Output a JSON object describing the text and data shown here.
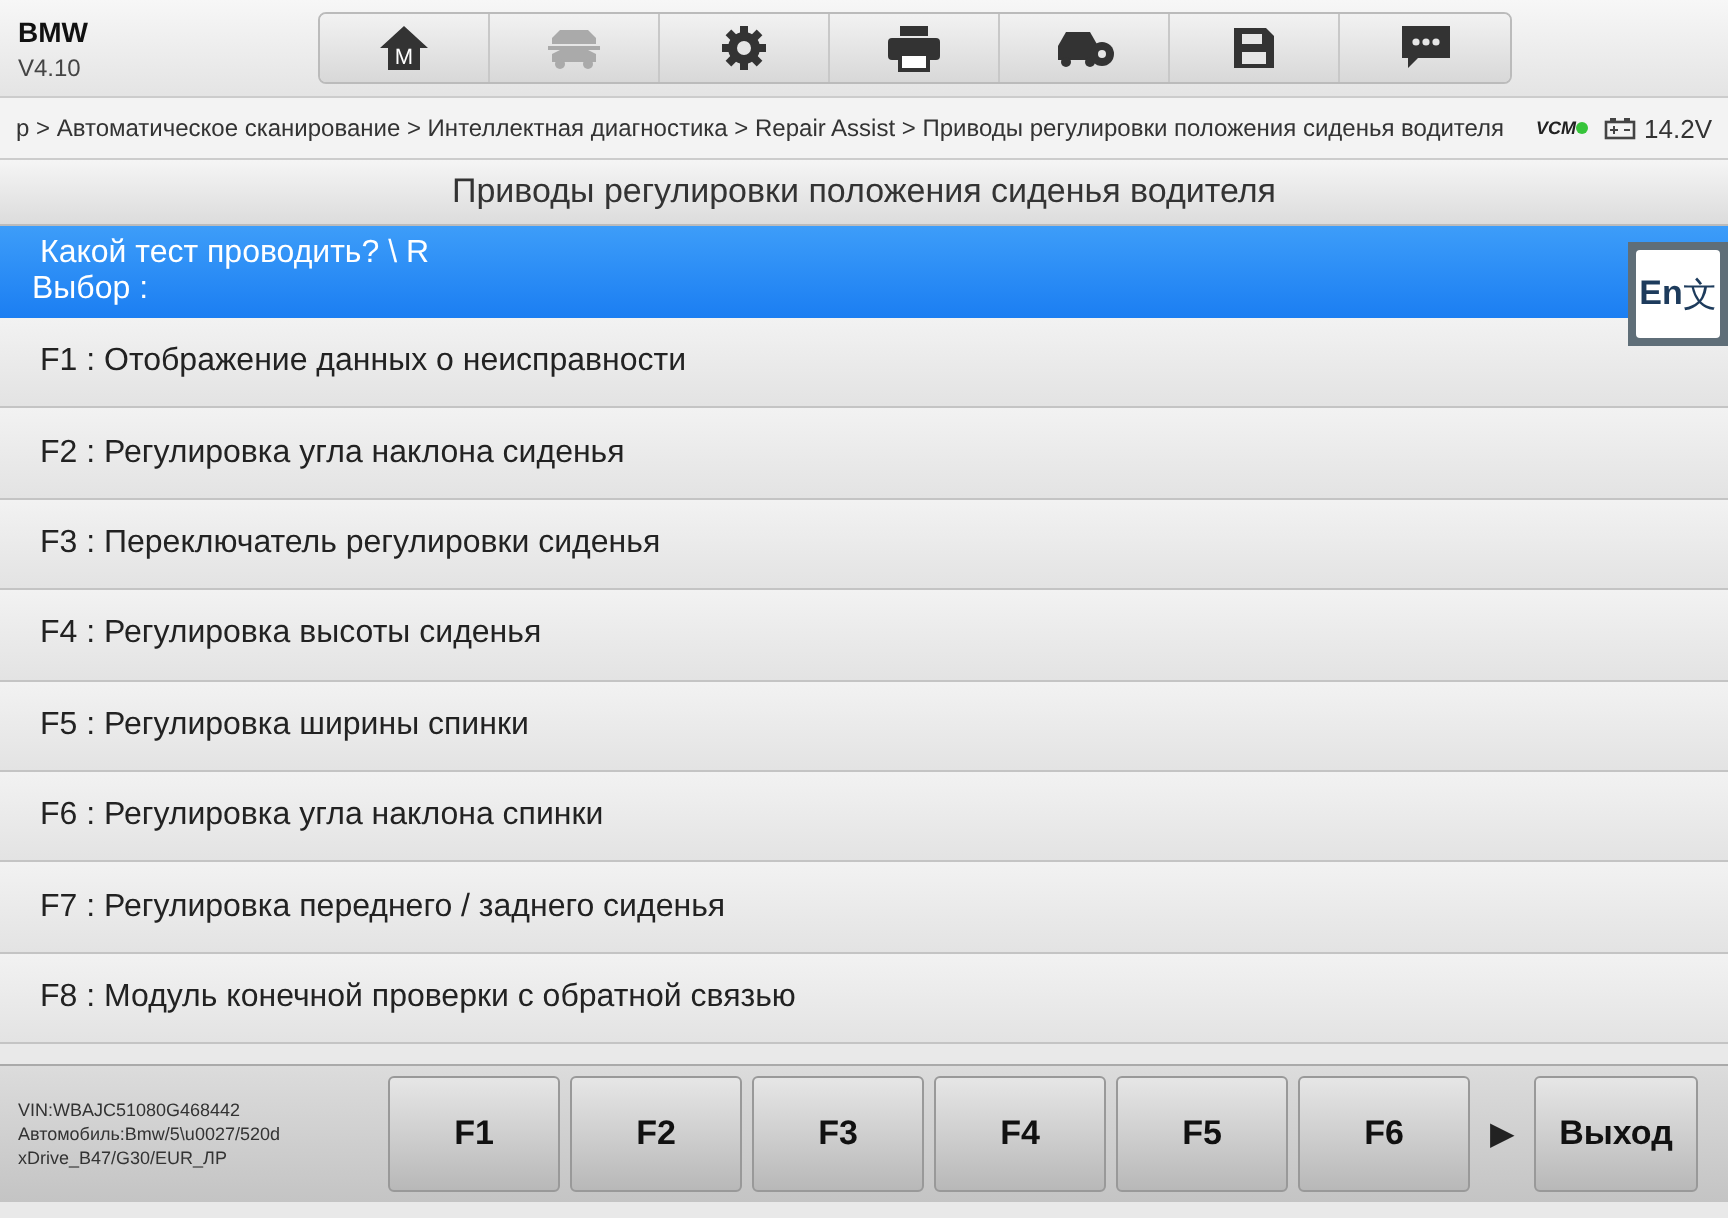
{
  "header": {
    "make": "BMW",
    "version": "V4.10"
  },
  "toolbar": [
    {
      "kind": "home",
      "badge": "M",
      "disabled": false
    },
    {
      "kind": "lift",
      "disabled": true
    },
    {
      "kind": "settings",
      "disabled": false
    },
    {
      "kind": "print",
      "disabled": false
    },
    {
      "kind": "car-gear",
      "disabled": false
    },
    {
      "kind": "save",
      "disabled": false
    },
    {
      "kind": "message",
      "disabled": false
    }
  ],
  "breadcrumb": "p > Автоматическое сканирование > Интеллектная диагностика > Repair Assist > Приводы регулировки положения сиденья водителя",
  "status": {
    "vcm": "VCM",
    "vcm_connected": true,
    "voltage": "14.2V"
  },
  "page_title": "Приводы регулировки положения сиденья водителя",
  "prompt": {
    "question": "Какой тест проводить? \\ R",
    "choice": "Выбор :"
  },
  "translate_button": {
    "text": "En",
    "glyph": "文"
  },
  "items": [
    {
      "label": "F1 : Отображение данных о неисправности"
    },
    {
      "label": "F2 : Регулировка угла наклона сиденья"
    },
    {
      "label": "F3 : Переключатель регулировки сиденья"
    },
    {
      "label": "F4 : Регулировка высоты сиденья"
    },
    {
      "label": "F5 : Регулировка ширины спинки"
    },
    {
      "label": "F6 : Регулировка угла наклона спинки"
    },
    {
      "label": "F7 : Регулировка переднего / заднего сиденья"
    },
    {
      "label": "F8 : Модуль конечной проверки с обратной связью"
    }
  ],
  "vehicle_info": [
    "VIN:WBAJC51080G468442",
    "Автомобиль:Bmw/5\\u0027/520d",
    "xDrive_B47/G30/EUR_ЛР"
  ],
  "function_keys": [
    "F1",
    "F2",
    "F3",
    "F4",
    "F5",
    "F6"
  ],
  "more_arrow": "▶",
  "exit_button": "Выход"
}
